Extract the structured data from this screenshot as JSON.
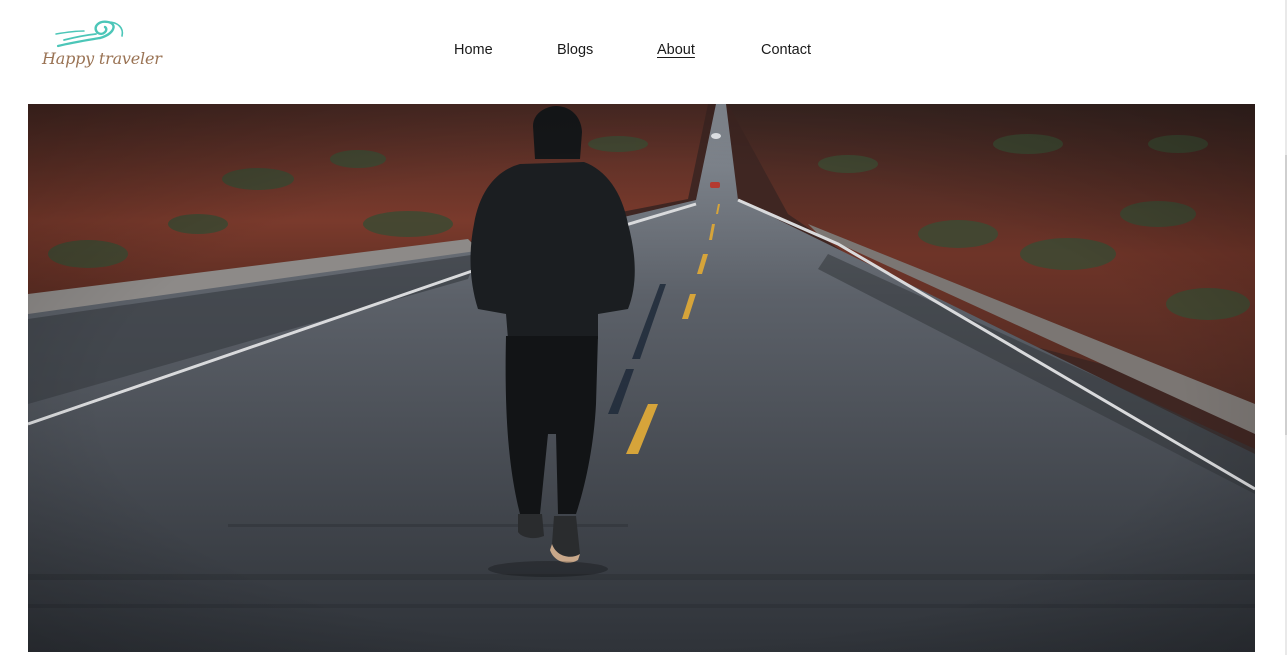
{
  "site": {
    "logo_text": "Happy traveler",
    "logo_icon": "wave-icon"
  },
  "nav": {
    "items": [
      {
        "label": "Home",
        "active": false
      },
      {
        "label": "Blogs",
        "active": false
      },
      {
        "label": "About",
        "active": true
      },
      {
        "label": "Contact",
        "active": false
      }
    ]
  },
  "hero": {
    "image": "person in hoodie walking down center of a long desert highway at dusk"
  },
  "colors": {
    "logo_teal": "#4cc6b8",
    "logo_text": "#9a7354",
    "nav_text": "#1a1a1a"
  }
}
